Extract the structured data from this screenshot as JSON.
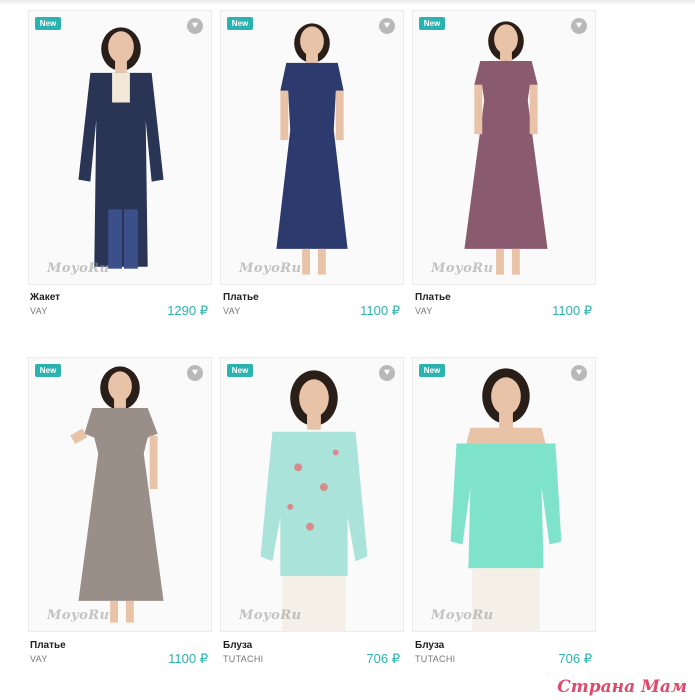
{
  "badge_label": "New",
  "watermark": "MoyoRu",
  "currency": "₽",
  "products": [
    {
      "name": "Жакет",
      "brand": "VAY",
      "price": "1290 ₽",
      "garment": "cardigan",
      "color": "#2a3556",
      "accent": "#101830"
    },
    {
      "name": "Платье",
      "brand": "VAY",
      "price": "1100 ₽",
      "garment": "maxi-dress-short-sleeve",
      "color": "#2c3a6e",
      "accent": "#1a2550"
    },
    {
      "name": "Платье",
      "brand": "VAY",
      "price": "1100 ₽",
      "garment": "maxi-dress-floral",
      "color": "#8a5a6e",
      "accent": "#5c3a4c"
    },
    {
      "name": "Платье",
      "brand": "VAY",
      "price": "1100 ₽",
      "garment": "maxi-dress-paisley",
      "color": "#9a8f88",
      "accent": "#5e5552"
    },
    {
      "name": "Блуза",
      "brand": "TUTACHI",
      "price": "706 ₽",
      "garment": "floral-blouse",
      "color": "#a9e3d9",
      "accent": "#d98a8a"
    },
    {
      "name": "Блуза",
      "brand": "TUTACHI",
      "price": "706 ₽",
      "garment": "off-shoulder-blouse",
      "color": "#7fe3cc",
      "accent": "#5ccfb5"
    }
  ],
  "site_brand": "Страна Мам"
}
